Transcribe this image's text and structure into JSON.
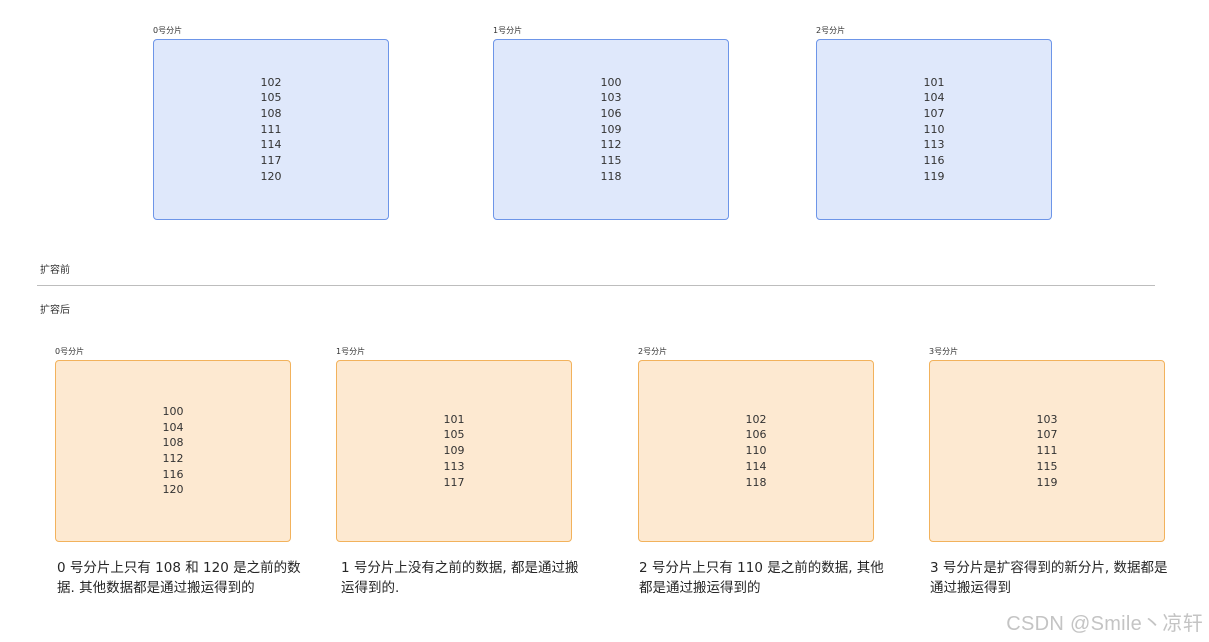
{
  "before": {
    "label": "扩容前",
    "shards": [
      {
        "title": "0号分片",
        "values": [
          "102",
          "105",
          "108",
          "111",
          "114",
          "117",
          "120"
        ]
      },
      {
        "title": "1号分片",
        "values": [
          "100",
          "103",
          "106",
          "109",
          "112",
          "115",
          "118"
        ]
      },
      {
        "title": "2号分片",
        "values": [
          "101",
          "104",
          "107",
          "110",
          "113",
          "116",
          "119"
        ]
      }
    ]
  },
  "after": {
    "label": "扩容后",
    "shards": [
      {
        "title": "0号分片",
        "values": [
          "100",
          "104",
          "108",
          "112",
          "116",
          "120"
        ],
        "caption": "0 号分片上只有 108 和 120 是之前的数据. 其他数据都是通过搬运得到的"
      },
      {
        "title": "1号分片",
        "values": [
          "101",
          "105",
          "109",
          "113",
          "117"
        ],
        "caption": "1 号分片上没有之前的数据, 都是通过搬运得到的."
      },
      {
        "title": "2号分片",
        "values": [
          "102",
          "106",
          "110",
          "114",
          "118"
        ],
        "caption": "2 号分片上只有 110 是之前的数据, 其他都是通过搬运得到的"
      },
      {
        "title": "3号分片",
        "values": [
          "103",
          "107",
          "111",
          "115",
          "119"
        ],
        "caption": "3 号分片是扩容得到的新分片, 数据都是通过搬运得到"
      }
    ]
  },
  "colors": {
    "before_fill": "#dfe8fb",
    "before_border": "#6d95e8",
    "after_fill": "#fde9d1",
    "after_border": "#f2b25c"
  },
  "watermark": "CSDN @Smile丶凉轩"
}
